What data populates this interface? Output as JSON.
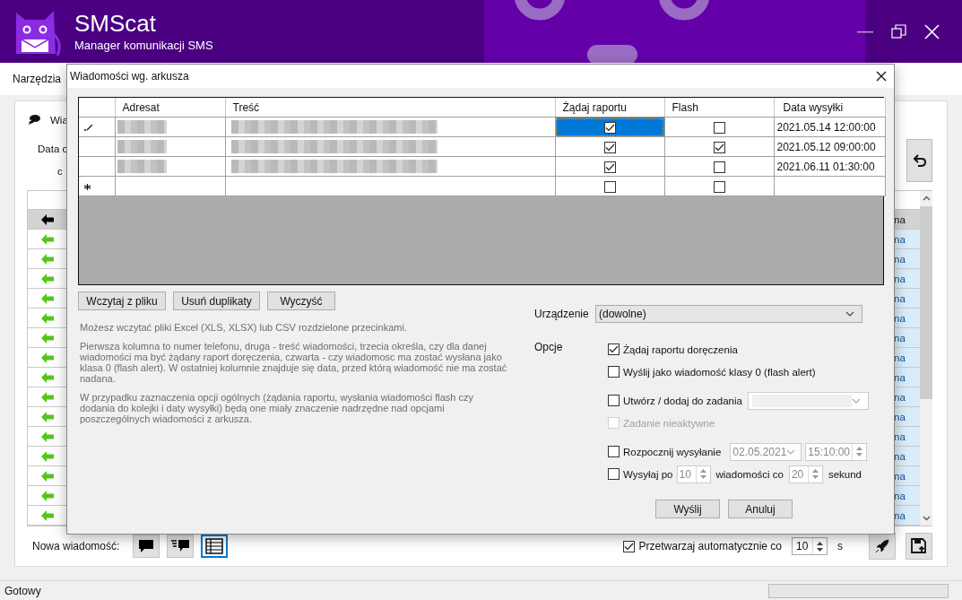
{
  "app": {
    "title": "SMScat",
    "subtitle": "Manager komunikacji SMS"
  },
  "menu": [
    {
      "label": "Narzędzia"
    }
  ],
  "main": {
    "tab_label": "Wia",
    "labels": [
      "Data c",
      "c"
    ],
    "list": {
      "rows": [
        {
          "column_2": "na",
          "selected": true
        },
        {
          "column_2": "na",
          "selected": false
        },
        {
          "column_2": "na",
          "selected": false
        },
        {
          "column_2": "na",
          "selected": false
        },
        {
          "column_2": "na",
          "selected": false
        },
        {
          "column_2": "na",
          "selected": false
        },
        {
          "column_2": "na",
          "selected": false
        },
        {
          "column_2": "na",
          "selected": false
        },
        {
          "column_2": "na",
          "selected": false
        },
        {
          "column_2": "na",
          "selected": false
        },
        {
          "column_2": "na",
          "selected": false
        },
        {
          "column_2": "na",
          "selected": false
        },
        {
          "column_2": "na",
          "selected": false
        },
        {
          "column_2": "na",
          "selected": false
        },
        {
          "column_2": "na",
          "selected": false
        },
        {
          "column_2": "na",
          "selected": false
        }
      ]
    },
    "new_message_label": "Nowa wiadomość:",
    "new_message_buttons": [
      {
        "kind": "single",
        "selected": false
      },
      {
        "kind": "multi",
        "selected": false
      },
      {
        "kind": "sheet",
        "selected": true
      }
    ],
    "auto_process": {
      "checked": true,
      "label": "Przetwarzaj automatycznie co",
      "value": "10",
      "unit": "s"
    }
  },
  "dialog": {
    "title": "Wiadomości wg. arkusza",
    "grid": {
      "columns": [
        "Adresat",
        "Treść",
        "Żądaj raportu",
        "Flash",
        "Data wysyłki"
      ],
      "rows": [
        {
          "kind": "editing",
          "blurred": true,
          "report": {
            "checked": true,
            "selected": true
          },
          "flash": {
            "checked": false,
            "selected": false
          },
          "date": "2021.05.14 12:00:00"
        },
        {
          "kind": "normal",
          "blurred": true,
          "report": {
            "checked": true,
            "selected": false
          },
          "flash": {
            "checked": true,
            "selected": false
          },
          "date": "2021.05.12 09:00:00"
        },
        {
          "kind": "normal",
          "blurred": true,
          "report": {
            "checked": true,
            "selected": false
          },
          "flash": {
            "checked": false,
            "selected": false
          },
          "date": "2021.06.11 01:30:00"
        },
        {
          "kind": "new",
          "blurred": false,
          "report": {
            "checked": false,
            "selected": false
          },
          "flash": {
            "checked": false,
            "selected": false
          }
        }
      ]
    },
    "buttons": [
      "Wczytaj z pliku",
      "Usuń duplikaty",
      "Wyczyść"
    ],
    "help": [
      "Możesz wczytać pliki Excel (XLS, XLSX) lub CSV rozdzielone przecinkami.",
      "Pierwsza kolumna to numer telefonu, druga - treść wiadomości, trzecia określa, czy dla danej wiadomości ma być żądany raport doręczenia, czwarta - czy wiadomosc ma zostać wysłana jako klasa 0 (flash alert). W ostatniej kolumnie znajduje się data, przed którą wiadomość nie ma zostać nadana.",
      "W przypadku zaznaczenia opcji ogólnych (żądania raportu, wysłania wiadomości flash czy dodania do kolejki i daty wysyłki) będą one miały znaczenie nadrzędne nad opcjami poszczególnych wiadomości z arkusza."
    ],
    "device": {
      "label": "Urządzenie",
      "value": "(dowolne)"
    },
    "options_label": "Opcje",
    "options": [
      {
        "kind": "check",
        "label": "Żądaj raportu doręczenia",
        "checked": true,
        "disabled": false
      },
      {
        "kind": "check",
        "label": "Wyślij jako wiadomość klasy 0 (flash alert)",
        "checked": false,
        "disabled": false
      },
      {
        "kind": "task",
        "label": "Utwórz / dodaj do zadania",
        "checked": false,
        "disabled": false
      },
      {
        "kind": "check",
        "label": "Zadanie nieaktywne",
        "checked": false,
        "disabled": true
      },
      {
        "kind": "schedule",
        "label": "Rozpocznij wysyłanie",
        "checked": false,
        "disabled": false,
        "date": "02.05.2021",
        "time": "15:10:00"
      },
      {
        "kind": "throttle",
        "label": "Wysyłaj po",
        "checked": false,
        "disabled": false,
        "count": "10",
        "middle": "wiadomości co",
        "seconds": "20",
        "unit": "sekund"
      }
    ],
    "actions": [
      "Wyślij",
      "Anuluj"
    ]
  },
  "status_bar": {
    "text": "Gotowy",
    "level": 0
  }
}
